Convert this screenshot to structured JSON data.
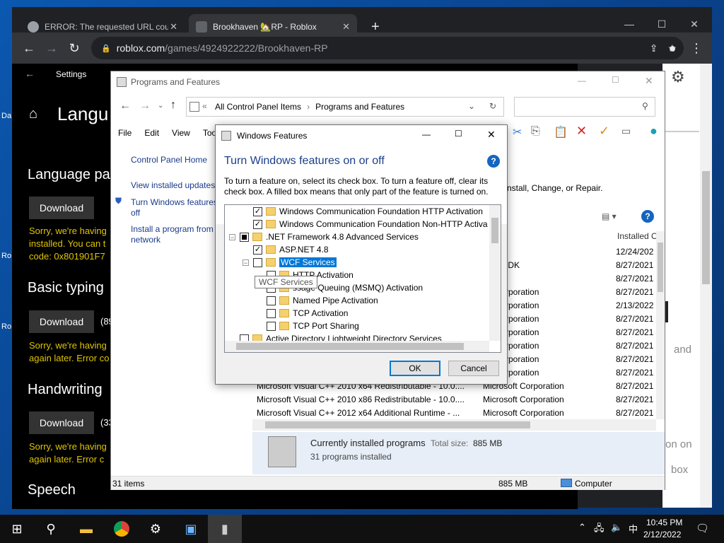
{
  "desktop": {
    "labels": [
      "Da",
      "Ro",
      "Ro"
    ]
  },
  "chrome": {
    "tabs": [
      {
        "title": "ERROR: The requested URL coul",
        "close": "✕"
      },
      {
        "title": "Brookhaven 🏡RP - Roblox",
        "close": "✕"
      }
    ],
    "new_tab": "+",
    "window_buttons": [
      "—",
      "☐",
      "✕"
    ],
    "url_host": "roblox.com",
    "url_path": "/games/4924922222/Brookhaven-RP"
  },
  "settings": {
    "back": "←",
    "title": "Settings",
    "heading": "Langu",
    "sections": [
      {
        "title": "Language pa",
        "button": "Download",
        "error": "Sorry, we're having",
        "error2": "installed. You can t",
        "error3": "code: 0x801901F7"
      },
      {
        "title": "Basic typing",
        "button": "Download",
        "size": "(89",
        "error": "Sorry, we're having",
        "error2": "again later. Error co"
      },
      {
        "title": "Handwriting",
        "button": "Download",
        "size": "(33",
        "error": "Sorry, we're having",
        "error2": "again later. Error c"
      },
      {
        "title": "Speech"
      }
    ]
  },
  "web_right": {
    "fragments": [
      "and",
      "on on",
      "box"
    ]
  },
  "programs": {
    "title": "Programs and Features",
    "address": [
      "All Control Panel Items",
      "Programs and Features"
    ],
    "menu": [
      "File",
      "Edit",
      "View",
      "Tools"
    ],
    "left_links": [
      "Control Panel Home",
      "View installed updates",
      "Turn Windows features on or off",
      "Install a program from the network"
    ],
    "left_links_display": {
      "home": "Control Panel Home",
      "updates": "View installed updates",
      "features1": "Turn Windows features",
      "features2": "off",
      "install1": "Install a program from",
      "install2": "network"
    },
    "main_text": "nstall, Change, or Repair.",
    "columns": {
      "publisher": "her",
      "installed": "Installed O"
    },
    "rows": [
      {
        "name": "",
        "publisher": "ovlov",
        "date": "12/24/202"
      },
      {
        "name": "",
        "publisher": "OpenJDK",
        "date": "8/27/2021"
      },
      {
        "name": "",
        "publisher": "LLC",
        "date": "8/27/2021"
      },
      {
        "name": "",
        "publisher": "oft Corporation",
        "date": "8/27/2021"
      },
      {
        "name": "",
        "publisher": "oft Corporation",
        "date": "2/13/2022"
      },
      {
        "name": "",
        "publisher": "oft Corporation",
        "date": "8/27/2021"
      },
      {
        "name": "",
        "publisher": "oft Corporation",
        "date": "8/27/2021"
      },
      {
        "name": "",
        "publisher": "oft Corporation",
        "date": "8/27/2021"
      },
      {
        "name": "",
        "publisher": "oft Corporation",
        "date": "8/27/2021"
      },
      {
        "name": "",
        "publisher": "oft Corporation",
        "date": "8/27/2021"
      },
      {
        "name": "Microsoft Visual C++ 2010  x64 Redistributable - 10.0....",
        "publisher": "Microsoft Corporation",
        "date": "8/27/2021"
      },
      {
        "name": "Microsoft Visual C++ 2010  x86 Redistributable - 10.0....",
        "publisher": "Microsoft Corporation",
        "date": "8/27/2021"
      },
      {
        "name": "Microsoft Visual C++ 2012 x64 Additional Runtime - ...",
        "publisher": "Microsoft Corporation",
        "date": "8/27/2021"
      }
    ],
    "info_title": "Currently installed programs",
    "info_size_label": "Total size:",
    "info_size": "885 MB",
    "info_count": "31 programs installed",
    "status_items": "31 items",
    "status_size": "885 MB",
    "status_zone": "Computer"
  },
  "features": {
    "title": "Windows Features",
    "heading": "Turn Windows features on or off",
    "description": "To turn a feature on, select its check box. To turn a feature off, clear its check box. A filled box means that only part of the feature is turned on.",
    "tree": [
      {
        "label": "Windows Communication Foundation HTTP Activation",
        "state": "checked"
      },
      {
        "label": "Windows Communication Foundation Non-HTTP Activa",
        "state": "checked"
      },
      {
        "label": ".NET Framework 4.8 Advanced Services",
        "state": "partial"
      },
      {
        "label": "ASP.NET 4.8",
        "state": "checked"
      },
      {
        "label": "WCF Services",
        "state": "unchecked"
      },
      {
        "label": "HTTP Activation",
        "state": "unchecked"
      },
      {
        "label": "ssage Queuing (MSMQ) Activation",
        "state": "unchecked"
      },
      {
        "label": "Named Pipe Activation",
        "state": "unchecked"
      },
      {
        "label": "TCP Activation",
        "state": "unchecked"
      },
      {
        "label": "TCP Port Sharing",
        "state": "unchecked"
      },
      {
        "label": "Active Directory Lightweight Directory Services",
        "state": "unchecked"
      }
    ],
    "tooltip": "WCF Services",
    "ok": "OK",
    "cancel": "Cancel",
    "help": "?"
  },
  "taskbar": {
    "time": "10:45 PM",
    "date": "2/12/2022",
    "ime": "中"
  },
  "colors": {
    "error_yellow": "#e0c500",
    "link_blue": "#1a3b8a",
    "heading_blue": "#1a3e8a",
    "selection": "#0078d7"
  }
}
